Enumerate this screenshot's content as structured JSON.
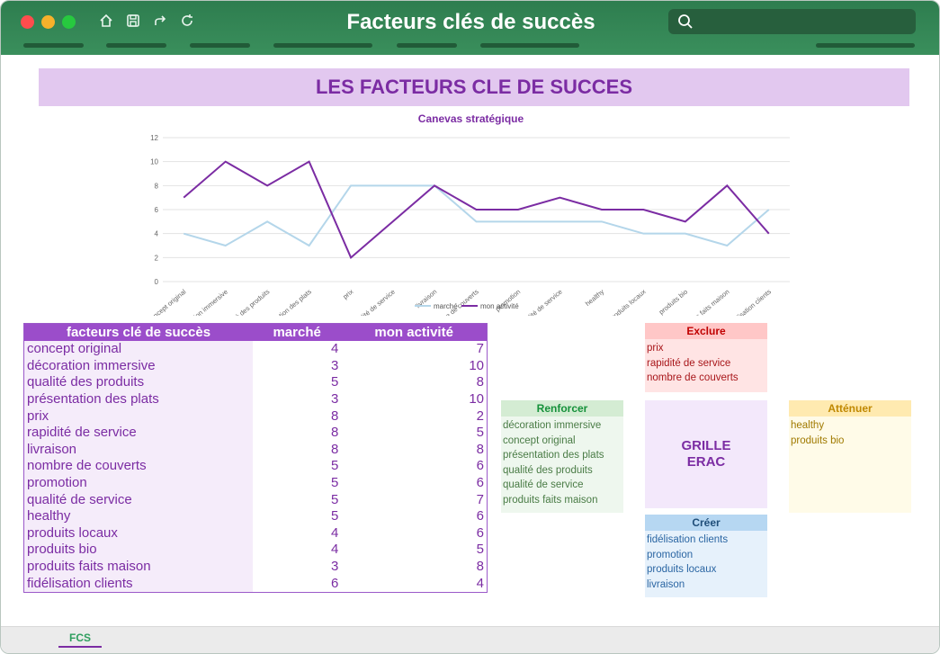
{
  "window": {
    "title": "Facteurs clés de succès"
  },
  "toolbar": {
    "icons": [
      "home-icon",
      "save-icon",
      "redo-icon",
      "refresh-icon"
    ]
  },
  "search": {
    "placeholder": ""
  },
  "banner": {
    "title": "LES FACTEURS CLE DE SUCCES"
  },
  "chart_data": {
    "type": "line",
    "title": "Canevas stratégique",
    "categories": [
      "concept original",
      "décoration immersive",
      "qualité des produits",
      "présentation des plats",
      "prix",
      "rapidité de service",
      "livraison",
      "nombre de couverts",
      "promotion",
      "qualité de service",
      "healthy",
      "produits locaux",
      "produits bio",
      "produits faits maison",
      "fidélisation clients"
    ],
    "series": [
      {
        "name": "marché",
        "values": [
          4,
          3,
          5,
          3,
          8,
          8,
          8,
          5,
          5,
          5,
          5,
          4,
          4,
          3,
          6
        ],
        "color": "#b4d6ea"
      },
      {
        "name": "mon activité",
        "values": [
          7,
          10,
          8,
          10,
          2,
          5,
          8,
          6,
          6,
          7,
          6,
          6,
          5,
          8,
          4
        ],
        "color": "#7b2ca3"
      }
    ],
    "yticks": [
      "0",
      "2",
      "4",
      "6",
      "8",
      "10",
      "12"
    ],
    "ylim": [
      0,
      12
    ],
    "grid": true,
    "legend": "bottom"
  },
  "table": {
    "headers": [
      "facteurs clé de succès",
      "marché",
      "mon activité"
    ],
    "rows": [
      [
        "concept original",
        "4",
        "7"
      ],
      [
        "décoration immersive",
        "3",
        "10"
      ],
      [
        "qualité des produits",
        "5",
        "8"
      ],
      [
        "présentation des plats",
        "3",
        "10"
      ],
      [
        "prix",
        "8",
        "2"
      ],
      [
        "rapidité de service",
        "8",
        "5"
      ],
      [
        "livraison",
        "8",
        "8"
      ],
      [
        "nombre de couverts",
        "5",
        "6"
      ],
      [
        "promotion",
        "5",
        "6"
      ],
      [
        "qualité de service",
        "5",
        "7"
      ],
      [
        "healthy",
        "5",
        "6"
      ],
      [
        "produits locaux",
        "4",
        "6"
      ],
      [
        "produits bio",
        "4",
        "5"
      ],
      [
        "produits faits maison",
        "3",
        "8"
      ],
      [
        "fidélisation clients",
        "6",
        "4"
      ]
    ]
  },
  "erac": {
    "grid_label_1": "GRILLE",
    "grid_label_2": "ERAC",
    "exclure": {
      "title": "Exclure",
      "items": [
        "prix",
        "rapidité de service",
        "nombre de couverts"
      ]
    },
    "renforcer": {
      "title": "Renforcer",
      "items": [
        "décoration immersive",
        "concept original",
        "présentation des plats",
        "qualité des produits",
        "qualité de service",
        "produits faits maison"
      ]
    },
    "attenuer": {
      "title": "Atténuer",
      "items": [
        "healthy",
        "produits bio"
      ]
    },
    "creer": {
      "title": "Créer",
      "items": [
        "fidélisation clients",
        "promotion",
        "produits locaux",
        "livraison"
      ]
    }
  },
  "footer": {
    "sheet_tab": "FCS"
  }
}
